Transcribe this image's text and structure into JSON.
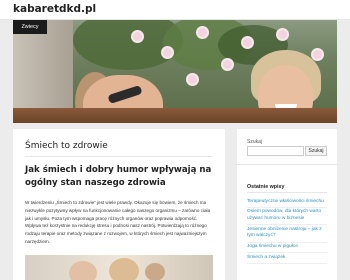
{
  "header": {
    "site_title": "kabaretdkd.pl"
  },
  "hero": {
    "nav_label": "Zwiecy"
  },
  "post": {
    "title": "Śmiech to zdrowie",
    "heading": "Jak śmiech i dobry humor wpływają na ogólny stan naszego zdrowia",
    "body": "W twierdzeniu „Śmiech to zdrowie” jest wiele prawdy. Okazuje się bowiem, że śmiech ma niezwykle pozytywny wpływ na funkcjonowanie całego naszego organizmu – zarówno ciała jak i umysłu. Poza tym wspomaga pracę różnych organów oraz poprawia odporność. Wpływa też korzystnie na redukcję stresu i podnosi nasz nastrój. Potwierdzają to różnego rodzaju terapie oraz metody związane z rozwojem, w których śmiech jest najważniejszym narzędziem."
  },
  "sidebar": {
    "search_label": "Szukaj",
    "search_value": "",
    "search_button": "Szukaj",
    "recent_title": "Ostatnie wpisy",
    "recent_posts": [
      {
        "label": "Terapeutyczne właściwości śmiechu"
      },
      {
        "label": "Osiem powodów, dla których warto używać humoru w biznesie"
      },
      {
        "label": "Jesienne obniżenie nastroju – jak z tym walczyć?"
      },
      {
        "label": "Joga śmiechu w pigułce"
      },
      {
        "label": "Śmiech a związek"
      }
    ]
  }
}
